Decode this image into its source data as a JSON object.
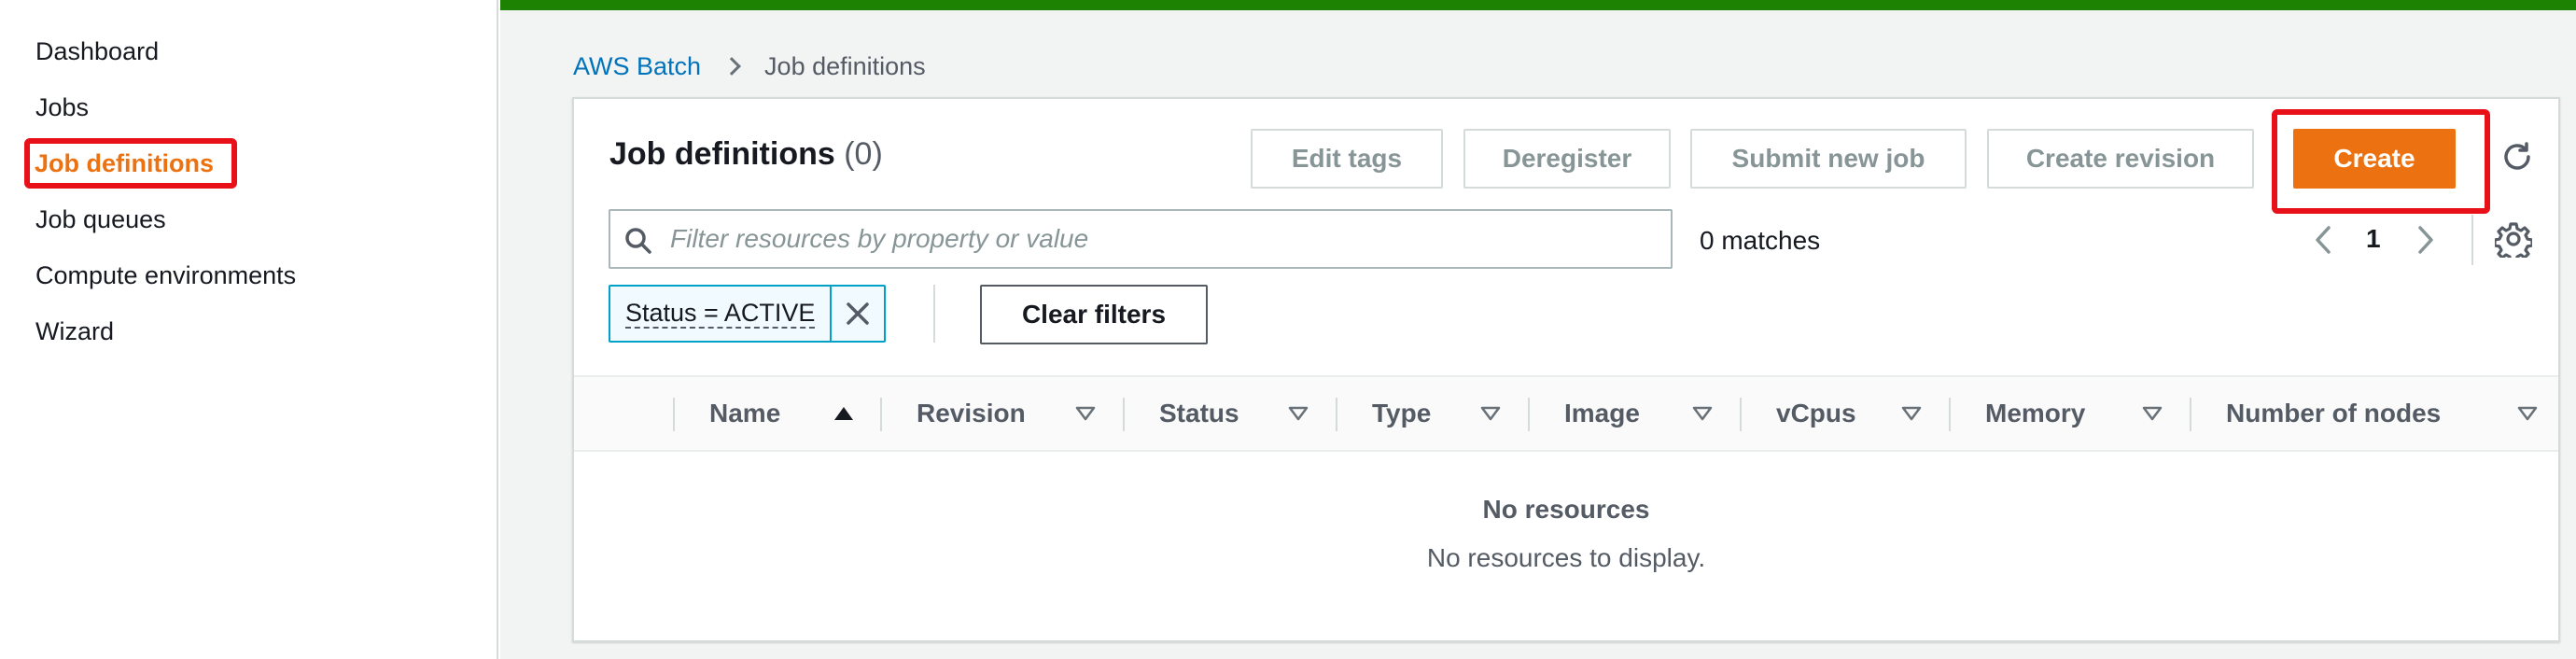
{
  "sidebar": {
    "items": [
      {
        "label": "Dashboard"
      },
      {
        "label": "Jobs"
      },
      {
        "label": "Job definitions",
        "active": true
      },
      {
        "label": "Job queues"
      },
      {
        "label": "Compute environments"
      },
      {
        "label": "Wizard"
      }
    ]
  },
  "breadcrumb": {
    "root": "AWS Batch",
    "current": "Job definitions"
  },
  "panel": {
    "title": "Job definitions",
    "count": "(0)"
  },
  "actions": {
    "edit_tags": "Edit tags",
    "deregister": "Deregister",
    "submit_new_job": "Submit new job",
    "create_revision": "Create revision",
    "create": "Create"
  },
  "search": {
    "placeholder": "Filter resources by property or value",
    "matches": "0 matches"
  },
  "pagination": {
    "current_page": "1"
  },
  "filter": {
    "token_label": "Status = ACTIVE",
    "clear_label": "Clear filters"
  },
  "table": {
    "columns": [
      "Name",
      "Revision",
      "Status",
      "Type",
      "Image",
      "vCpus",
      "Memory",
      "Number of nodes"
    ],
    "sorted_column": "Name",
    "sort_direction": "ascending",
    "empty_title": "No resources",
    "empty_description": "No resources to display."
  },
  "colors": {
    "accent": "#ec7211",
    "link": "#0073bb",
    "status_bar": "#1d8102",
    "highlight": "#e8111a"
  },
  "icons": [
    "search-icon",
    "close-icon",
    "refresh-icon",
    "settings-gear-icon",
    "chevron-left-icon",
    "chevron-right-icon",
    "chevron-right-breadcrumb-icon",
    "sort-ascending-icon",
    "sort-descending-icon"
  ]
}
